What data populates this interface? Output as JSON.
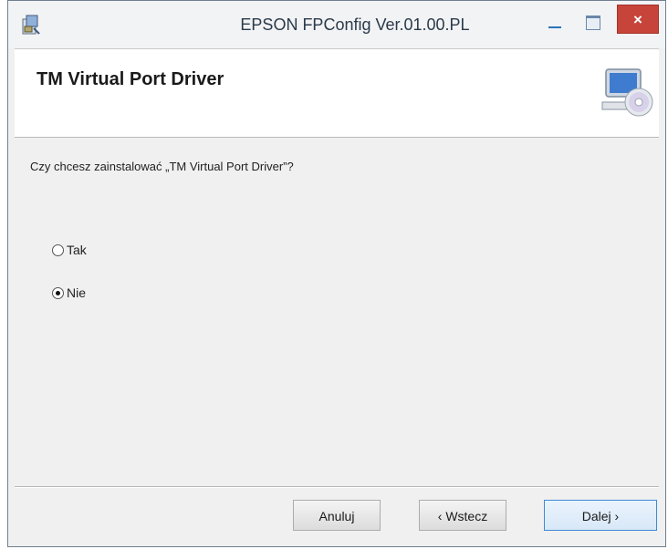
{
  "window": {
    "title": "EPSON FPConfig Ver.01.00.PL",
    "close_label": "×"
  },
  "header": {
    "title": "TM Virtual Port Driver"
  },
  "content": {
    "question": "Czy chcesz zainstalować „TM Virtual Port Driver”?",
    "options": [
      {
        "label": "Tak",
        "selected": false
      },
      {
        "label": "Nie",
        "selected": true
      }
    ]
  },
  "footer": {
    "cancel_label": "Anuluj",
    "back_label": "‹ Wstecz",
    "next_label": "Dalej ›"
  },
  "colors": {
    "close_button": "#c7443a",
    "default_button_border": "#3c8ad6"
  },
  "icons": {
    "app": "installer-icon",
    "header": "computer-cd-icon"
  }
}
